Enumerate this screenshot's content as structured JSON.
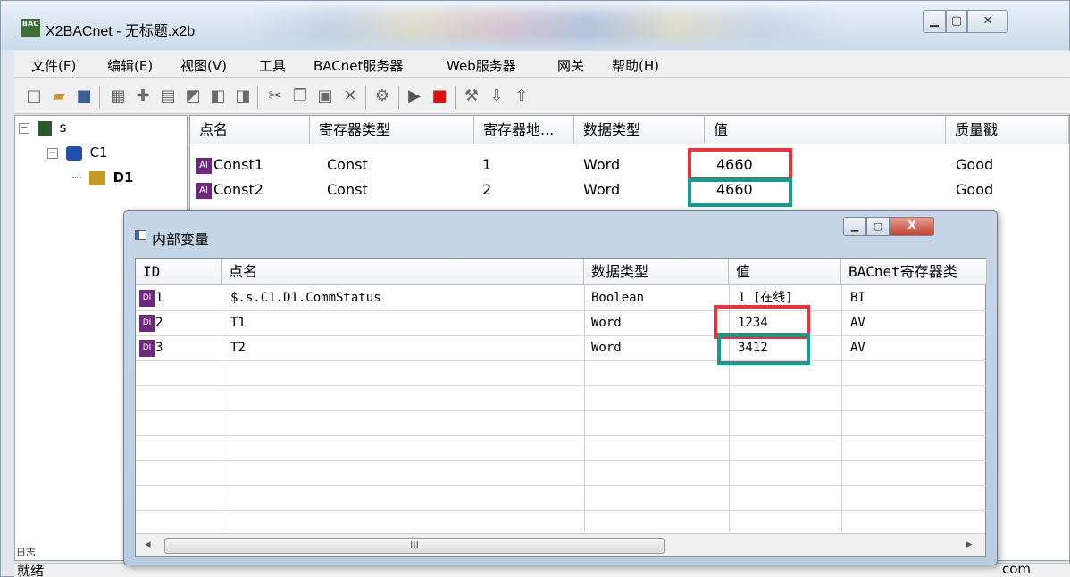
{
  "window": {
    "title": "X2BACnet - 无标题.x2b",
    "app_icon_text": "BAC",
    "min_label": "▁",
    "max_label": "▢",
    "close_label": "✕"
  },
  "menu": [
    "文件(F)",
    "编辑(E)",
    "视图(V)",
    "工具",
    "BACnet服务器",
    "Web服务器",
    "网关",
    "帮助(H)"
  ],
  "tree": {
    "root": "s",
    "channel": "C1",
    "device": "D1",
    "collapse_symbol": "−"
  },
  "grid": {
    "headers": [
      "点名",
      "寄存器类型",
      "寄存器地...",
      "数据类型",
      "值",
      "质量戳"
    ],
    "rows": [
      {
        "icon": "AI",
        "name": "Const1",
        "reg_type": "Const",
        "addr": "1",
        "dtype": "Word",
        "value": "4660",
        "quality": "Good"
      },
      {
        "icon": "AI",
        "name": "Const2",
        "reg_type": "Const",
        "addr": "2",
        "dtype": "Word",
        "value": "4660",
        "quality": "Good"
      }
    ]
  },
  "statusbar": {
    "text": "就绪",
    "right_fragment": "com"
  },
  "left_bottom_label": "日志",
  "dialog": {
    "title": "内部变量",
    "headers": [
      "ID",
      "点名",
      "数据类型",
      "值",
      "BACnet寄存器类"
    ],
    "rows": [
      {
        "id": "1",
        "name": "$.s.C1.D1.CommStatus",
        "dtype": "Boolean",
        "value": "1 [在线]",
        "bacnet": "BI"
      },
      {
        "id": "2",
        "name": "T1",
        "dtype": "Word",
        "value": "1234",
        "bacnet": "AV"
      },
      {
        "id": "3",
        "name": "T2",
        "dtype": "Word",
        "value": "3412",
        "bacnet": "AV"
      }
    ],
    "scroll_thumb_label": "III",
    "scroll_left": "◂",
    "scroll_right": "▸",
    "min_label": "▁",
    "max_label": "▢",
    "close_label": "X"
  },
  "highlight_colors": {
    "red": "#e8333a",
    "teal": "#159a90"
  }
}
